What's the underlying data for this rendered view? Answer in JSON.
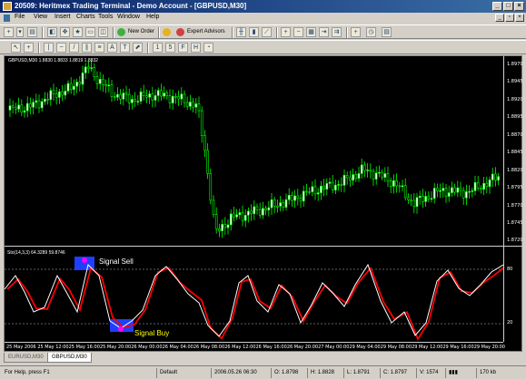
{
  "window": {
    "title": "20509: Heritmex Trading Terminal - Demo Account - [GBPUSD,M30]"
  },
  "menu": [
    "File",
    "View",
    "Insert",
    "Charts",
    "Tools",
    "Window",
    "Help"
  ],
  "toolbar": {
    "new_order": "New Order",
    "expert_advisors": "Expert Advisors"
  },
  "chart": {
    "legend": "GBPUSD,M30 1.8830 1.8833 1.8819 1.8832",
    "price_labels": [
      "1.8970",
      "1.8945",
      "1.8920",
      "1.8895",
      "1.8870",
      "1.8845",
      "1.8820",
      "1.8795",
      "1.8770",
      "1.8745",
      "1.8720"
    ],
    "time_labels": [
      "25 May 2006",
      "25 May 12:00",
      "25 May 16:00",
      "25 May 20:00",
      "26 May 00:00",
      "26 May 04:00",
      "26 May 08:00",
      "26 May 12:00",
      "26 May 16:00",
      "26 May 20:00",
      "27 May 00:00",
      "29 May 04:00",
      "29 May 08:00",
      "29 May 12:00",
      "29 May 16:00",
      "29 May 20:00"
    ],
    "candle_color": "#00ff00",
    "background": "#000000"
  },
  "oscillator": {
    "legend": "Sto(14,3,3) 64.3289 59.8746",
    "levels": [
      "80",
      "20"
    ],
    "main_color": "#ffffff",
    "signal_color": "#ff0000",
    "signal_sell": "Signal Sell",
    "signal_buy": "Signal Buy"
  },
  "tabs": [
    "EURUSD,M30",
    "GBPUSD,M30"
  ],
  "status": {
    "help": "For Help, press F1",
    "profile": "Default",
    "datetime": "2006.05.26 06:30",
    "open": "O: 1.8798",
    "high": "H: 1.8828",
    "low": "L: 1.8791",
    "close": "C: 1.8797",
    "volume": "V: 1574",
    "traffic": "170 kb"
  }
}
